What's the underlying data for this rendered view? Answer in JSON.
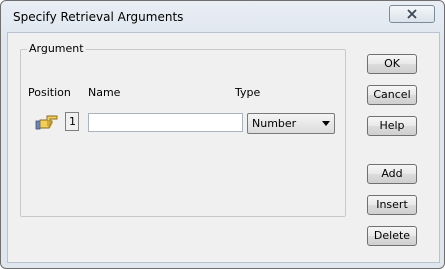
{
  "window": {
    "title": "Specify Retrieval Arguments"
  },
  "argument_group": {
    "label": "Argument",
    "columns": {
      "position": "Position",
      "name": "Name",
      "type": "Type"
    },
    "row": {
      "position": "1",
      "name_value": "",
      "type_value": "Number"
    }
  },
  "buttons": {
    "ok": "OK",
    "cancel": "Cancel",
    "help": "Help",
    "add": "Add",
    "insert": "Insert",
    "delete": "Delete"
  },
  "icons": {
    "close": "close-icon",
    "row_pointer": "pointing-hand-icon",
    "dropdown": "chevron-down-icon"
  }
}
